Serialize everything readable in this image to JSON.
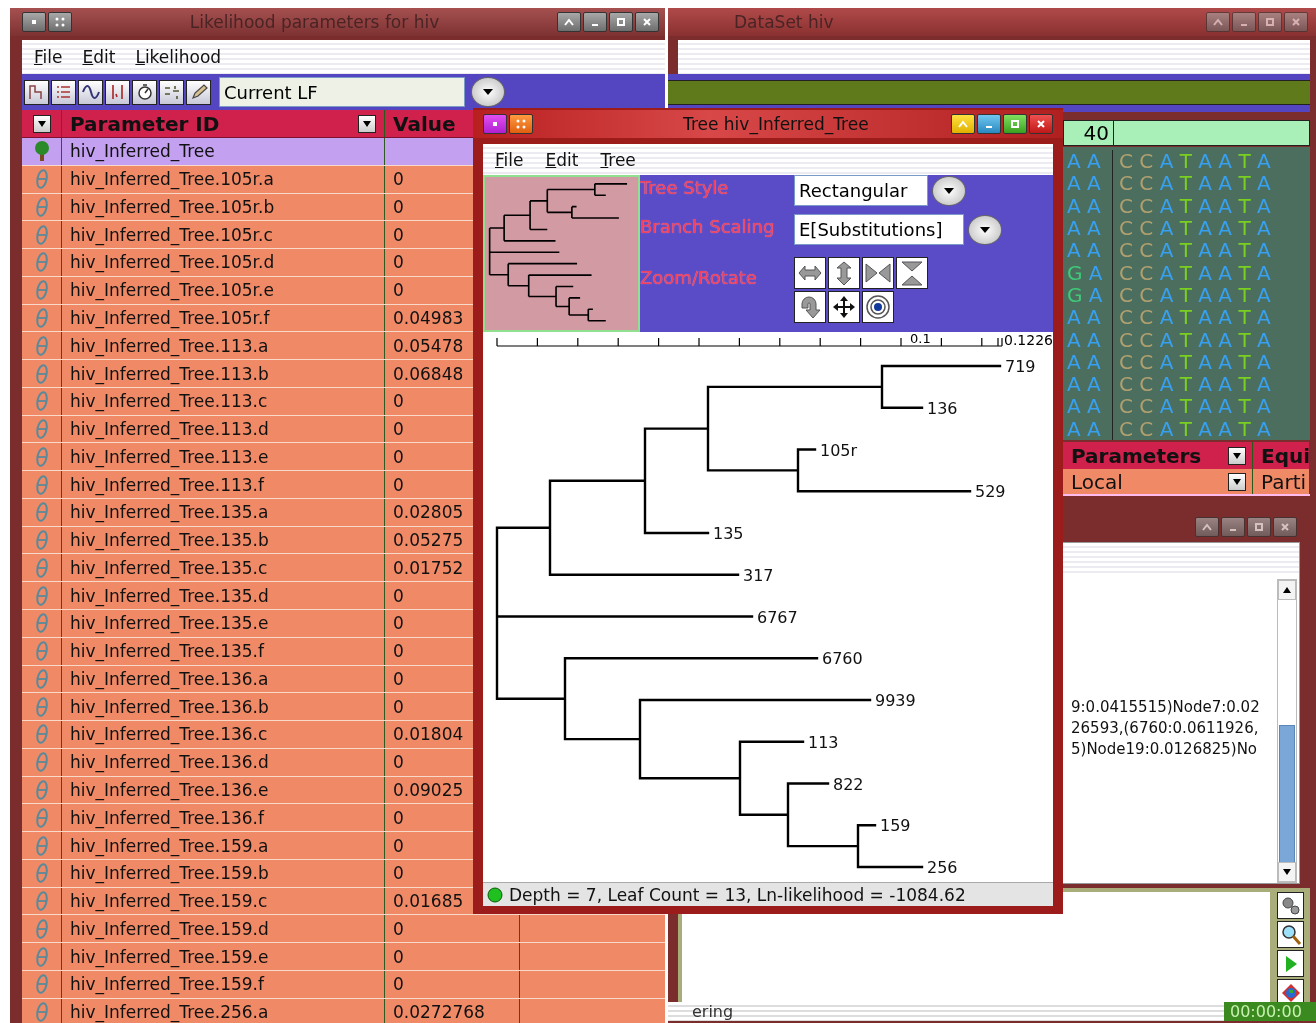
{
  "param_window": {
    "title": "Likelihood parameters for hiv",
    "menu": [
      "File",
      "Edit",
      "Likelihood"
    ],
    "lf_selector": {
      "value": "Current LF"
    },
    "columns": [
      "Parameter ID",
      "Value"
    ],
    "rows": [
      {
        "id": "hiv_Inferred_Tree",
        "value": "",
        "kind": "tree",
        "selected": true
      },
      {
        "id": "hiv_Inferred_Tree.105r.a",
        "value": "0",
        "kind": "parameter",
        "selected": false
      },
      {
        "id": "hiv_Inferred_Tree.105r.b",
        "value": "0",
        "kind": "parameter",
        "selected": false
      },
      {
        "id": "hiv_Inferred_Tree.105r.c",
        "value": "0",
        "kind": "parameter",
        "selected": false
      },
      {
        "id": "hiv_Inferred_Tree.105r.d",
        "value": "0",
        "kind": "parameter",
        "selected": false
      },
      {
        "id": "hiv_Inferred_Tree.105r.e",
        "value": "0",
        "kind": "parameter",
        "selected": false
      },
      {
        "id": "hiv_Inferred_Tree.105r.f",
        "value": "0.04983",
        "kind": "parameter",
        "selected": false
      },
      {
        "id": "hiv_Inferred_Tree.113.a",
        "value": "0.05478",
        "kind": "parameter",
        "selected": false
      },
      {
        "id": "hiv_Inferred_Tree.113.b",
        "value": "0.06848",
        "kind": "parameter",
        "selected": false
      },
      {
        "id": "hiv_Inferred_Tree.113.c",
        "value": "0",
        "kind": "parameter",
        "selected": false
      },
      {
        "id": "hiv_Inferred_Tree.113.d",
        "value": "0",
        "kind": "parameter",
        "selected": false
      },
      {
        "id": "hiv_Inferred_Tree.113.e",
        "value": "0",
        "kind": "parameter",
        "selected": false
      },
      {
        "id": "hiv_Inferred_Tree.113.f",
        "value": "0",
        "kind": "parameter",
        "selected": false
      },
      {
        "id": "hiv_Inferred_Tree.135.a",
        "value": "0.02805",
        "kind": "parameter",
        "selected": false
      },
      {
        "id": "hiv_Inferred_Tree.135.b",
        "value": "0.05275",
        "kind": "parameter",
        "selected": false
      },
      {
        "id": "hiv_Inferred_Tree.135.c",
        "value": "0.01752",
        "kind": "parameter",
        "selected": false
      },
      {
        "id": "hiv_Inferred_Tree.135.d",
        "value": "0",
        "kind": "parameter",
        "selected": false
      },
      {
        "id": "hiv_Inferred_Tree.135.e",
        "value": "0",
        "kind": "parameter",
        "selected": false
      },
      {
        "id": "hiv_Inferred_Tree.135.f",
        "value": "0",
        "kind": "parameter",
        "selected": false
      },
      {
        "id": "hiv_Inferred_Tree.136.a",
        "value": "0",
        "kind": "parameter",
        "selected": false
      },
      {
        "id": "hiv_Inferred_Tree.136.b",
        "value": "0",
        "kind": "parameter",
        "selected": false
      },
      {
        "id": "hiv_Inferred_Tree.136.c",
        "value": "0.01804",
        "kind": "parameter",
        "selected": false
      },
      {
        "id": "hiv_Inferred_Tree.136.d",
        "value": "0",
        "kind": "parameter",
        "selected": false
      },
      {
        "id": "hiv_Inferred_Tree.136.e",
        "value": "0.09025",
        "kind": "parameter",
        "selected": false
      },
      {
        "id": "hiv_Inferred_Tree.136.f",
        "value": "0",
        "kind": "parameter",
        "selected": false
      },
      {
        "id": "hiv_Inferred_Tree.159.a",
        "value": "0",
        "kind": "parameter",
        "selected": false
      },
      {
        "id": "hiv_Inferred_Tree.159.b",
        "value": "0",
        "kind": "parameter",
        "selected": false
      },
      {
        "id": "hiv_Inferred_Tree.159.c",
        "value": "0.01685",
        "kind": "parameter",
        "selected": false
      },
      {
        "id": "hiv_Inferred_Tree.159.d",
        "value": "0",
        "kind": "parameter",
        "selected": false
      },
      {
        "id": "hiv_Inferred_Tree.159.e",
        "value": "0",
        "kind": "parameter",
        "selected": false
      },
      {
        "id": "hiv_Inferred_Tree.159.f",
        "value": "0",
        "kind": "parameter",
        "selected": false
      },
      {
        "id": "hiv_Inferred_Tree.256.a",
        "value": "0.0272768",
        "kind": "parameter",
        "selected": false
      }
    ]
  },
  "tree_window": {
    "title": "Tree hiv_Inferred_Tree",
    "menu": [
      "File",
      "Edit",
      "Tree"
    ],
    "tree_style": {
      "label": "Tree Style",
      "value": "Rectangular"
    },
    "branch_scaling": {
      "label": "Branch Scaling",
      "value": "E[Substitutions]"
    },
    "zoom_label": "Zoom/Rotate",
    "scale_labels": [
      "0.1",
      "0.1226"
    ],
    "tree": {
      "children": [
        {
          "children": [
            {
              "children": [
                {
                  "children": [
                    {
                      "children": [
                        {
                          "label": "719"
                        },
                        {
                          "label": "136"
                        }
                      ]
                    },
                    {
                      "children": [
                        {
                          "label": "105r"
                        },
                        {
                          "label": "529"
                        }
                      ]
                    }
                  ]
                },
                {
                  "label": "135"
                }
              ]
            },
            {
              "label": "317"
            }
          ]
        },
        {
          "label": "6767"
        },
        {
          "children": [
            {
              "label": "6760"
            },
            {
              "children": [
                {
                  "label": "9939"
                },
                {
                  "children": [
                    {
                      "label": "113"
                    },
                    {
                      "children": [
                        {
                          "label": "822"
                        },
                        {
                          "children": [
                            {
                              "label": "159"
                            },
                            {
                              "label": "256"
                            }
                          ]
                        }
                      ]
                    }
                  ]
                }
              ]
            }
          ]
        }
      ]
    },
    "status": "Depth = 7, Leaf Count = 13, Ln-likelihood = -1084.62"
  },
  "dataset_window": {
    "title": "DataSet hiv",
    "column_header": "40",
    "sequences": [
      {
        "left": "A A",
        "right": "C C A T A A T A"
      },
      {
        "left": "A A",
        "right": "C C A T A A T A"
      },
      {
        "left": "A A",
        "right": "C C A T A A T A"
      },
      {
        "left": "A A",
        "right": "C C A T A A T A"
      },
      {
        "left": "A A",
        "right": "C C A T A A T A"
      },
      {
        "left": "G A",
        "right": "C C A T A A T A"
      },
      {
        "left": "G A",
        "right": "C C A T A A T A"
      },
      {
        "left": "A A",
        "right": "C C A T A A T A"
      },
      {
        "left": "A A",
        "right": "C C A T A A T A"
      },
      {
        "left": "A A",
        "right": "C C A T A A T A"
      },
      {
        "left": "A A",
        "right": "C C A T A A T A"
      },
      {
        "left": "A A",
        "right": "C C A T A A T A"
      },
      {
        "left": "A A",
        "right": "C C A T A A T A"
      }
    ],
    "partition_table": {
      "columns": [
        "Parameters",
        "Equi"
      ],
      "row": [
        "Local",
        "Parti"
      ]
    },
    "console_lines": [
      "9:0.0415515)Node7:0.02",
      "26593,(6760:0.0611926,",
      "5)Node19:0.0126825)No"
    ],
    "status": "ering",
    "timer": "00:00:00"
  }
}
